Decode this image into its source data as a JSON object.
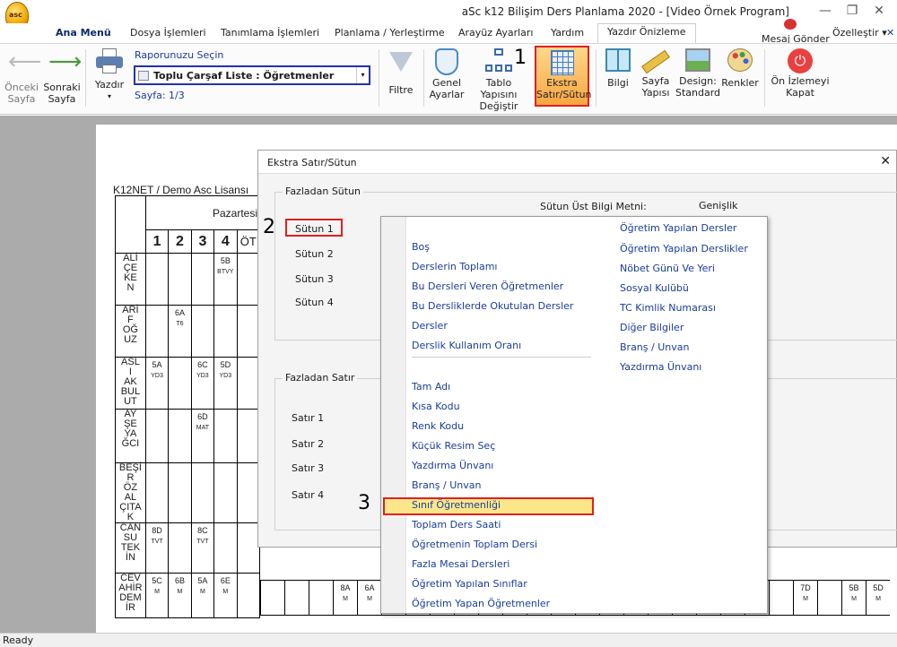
{
  "window": {
    "title": "aSc k12 Bilişim Ders Planlama 2020  - [Video Örnek Program]",
    "app_icon_text": "asc"
  },
  "menu": {
    "items": [
      "Ana Menü",
      "Dosya İşlemleri",
      "Tanımlama İşlemleri",
      "Planlama / Yerleştirme",
      "Arayüz Ayarları",
      "Yardım",
      "Yazdır Önizleme"
    ],
    "message": "Mesaj Gönder",
    "customize": "Özelleştir ▾"
  },
  "ribbon": {
    "prev": "Önceki\nSayfa",
    "next": "Sonraki\nSayfa",
    "print": "Yazdır",
    "report_label": "Raporunuzu Seçin",
    "report_value": "Toplu Çarşaf Liste : Öğretmenler",
    "page_info": "Sayfa: 1/3",
    "filter": "Filtre",
    "general": "Genel\nAyarlar",
    "table_struct": "Tablo Yapısını\nDeğiştir",
    "extra": "Ekstra\nSatır/Sütun",
    "info": "Bilgi",
    "page_struct": "Sayfa\nYapısı",
    "design": "Design:\nStandard",
    "colors": "Renkler",
    "close_preview": "Ön İzlemeyi\nKapat"
  },
  "steps": [
    "1",
    "2",
    "3"
  ],
  "preview": {
    "license": "K12NET / Demo Asc Lisansı",
    "day": "Pazartesi",
    "periods": [
      "1",
      "2",
      "3",
      "4",
      "ÖT"
    ],
    "teachers": [
      {
        "name": "ALİ ÇE KE N",
        "cells": [
          [
            "",
            ""
          ],
          [
            "",
            ""
          ],
          [
            "",
            ""
          ],
          [
            "5B",
            "BTVY"
          ]
        ]
      },
      {
        "name": "ARİ F OĞ UZ",
        "cells": [
          [
            "",
            ""
          ],
          [
            "6A",
            "T6"
          ],
          [
            "",
            ""
          ],
          [
            "",
            ""
          ]
        ]
      },
      {
        "name": "ASL I AK BUL UT",
        "cells": [
          [
            "5A",
            "YD3"
          ],
          [
            "",
            ""
          ],
          [
            "6C",
            "YD3"
          ],
          [
            "5D",
            "YD3"
          ]
        ]
      },
      {
        "name": "AY ŞE YA ĞCI",
        "cells": [
          [
            "",
            ""
          ],
          [
            "",
            ""
          ],
          [
            "6D",
            "MAT"
          ],
          [
            "",
            ""
          ]
        ]
      },
      {
        "name": "BEŞİ R ÖZ AL ÇITA K",
        "cells": [
          [
            "",
            ""
          ],
          [
            "",
            ""
          ],
          [
            "",
            ""
          ],
          [
            "",
            ""
          ]
        ]
      },
      {
        "name": "CAN SU TEK İN",
        "cells": [
          [
            "8D",
            "TVT"
          ],
          [
            "",
            ""
          ],
          [
            "8C",
            "TVT"
          ],
          [
            "",
            ""
          ]
        ]
      },
      {
        "name": "CEV AHİR DEM İR",
        "cells": [
          [
            "5C",
            "M"
          ],
          [
            "6B",
            "M"
          ],
          [
            "5A",
            "M"
          ],
          [
            "6E",
            "M"
          ]
        ]
      }
    ],
    "bottom_cells": [
      [
        "8A",
        "M"
      ],
      [
        "6A",
        "M"
      ],
      [
        "7D",
        "M"
      ],
      [
        "5B",
        "M"
      ],
      [
        "5D",
        "M"
      ]
    ]
  },
  "dialog": {
    "title": "Ekstra Satır/Sütun",
    "col_group": "Fazladan Sütun",
    "col_header_text": "Sütun Üst  Bilgi Metni:",
    "col_width": "Genişlik",
    "columns": [
      "Sütun 1",
      "Sütun 2",
      "Sütun 3",
      "Sütun 4"
    ],
    "row_group": "Fazladan Satır",
    "rows": [
      "Satır 1",
      "Satır 2",
      "Satır 3",
      "Satır 4"
    ]
  },
  "popup": {
    "left": [
      "Boş",
      "Derslerin Toplamı",
      "Bu Dersleri Veren Öğretmenler",
      "Bu Dersliklerde Okutulan Dersler",
      "Dersler",
      "Derslik Kullanım Oranı"
    ],
    "left2": [
      "Tam Adı",
      "Kısa Kodu",
      "Renk Kodu",
      "Küçük Resim Seç",
      "Yazdırma Ünvanı",
      "Branş / Unvan",
      "Sınıf Öğretmenliği",
      "Toplam Ders Saati",
      "Öğretmenin Toplam Dersi",
      "Fazla Mesai Dersleri",
      "Öğretim Yapılan Sınıflar",
      "Öğretim Yapan Öğretmenler"
    ],
    "right": [
      "Öğretim Yapılan Dersler",
      "Öğretim Yapılan Derslikler",
      "Nöbet Günü Ve Yeri",
      "Sosyal Kulübü",
      "TC Kimlik Numarası",
      "Diğer Bilgiler",
      "Branş / Unvan",
      "Yazdırma Ünvanı"
    ]
  },
  "status": "Ready",
  "colors": {
    "accent": "#e02020",
    "ribbon_select": "#2233aa",
    "highlight": "#fce68a"
  }
}
